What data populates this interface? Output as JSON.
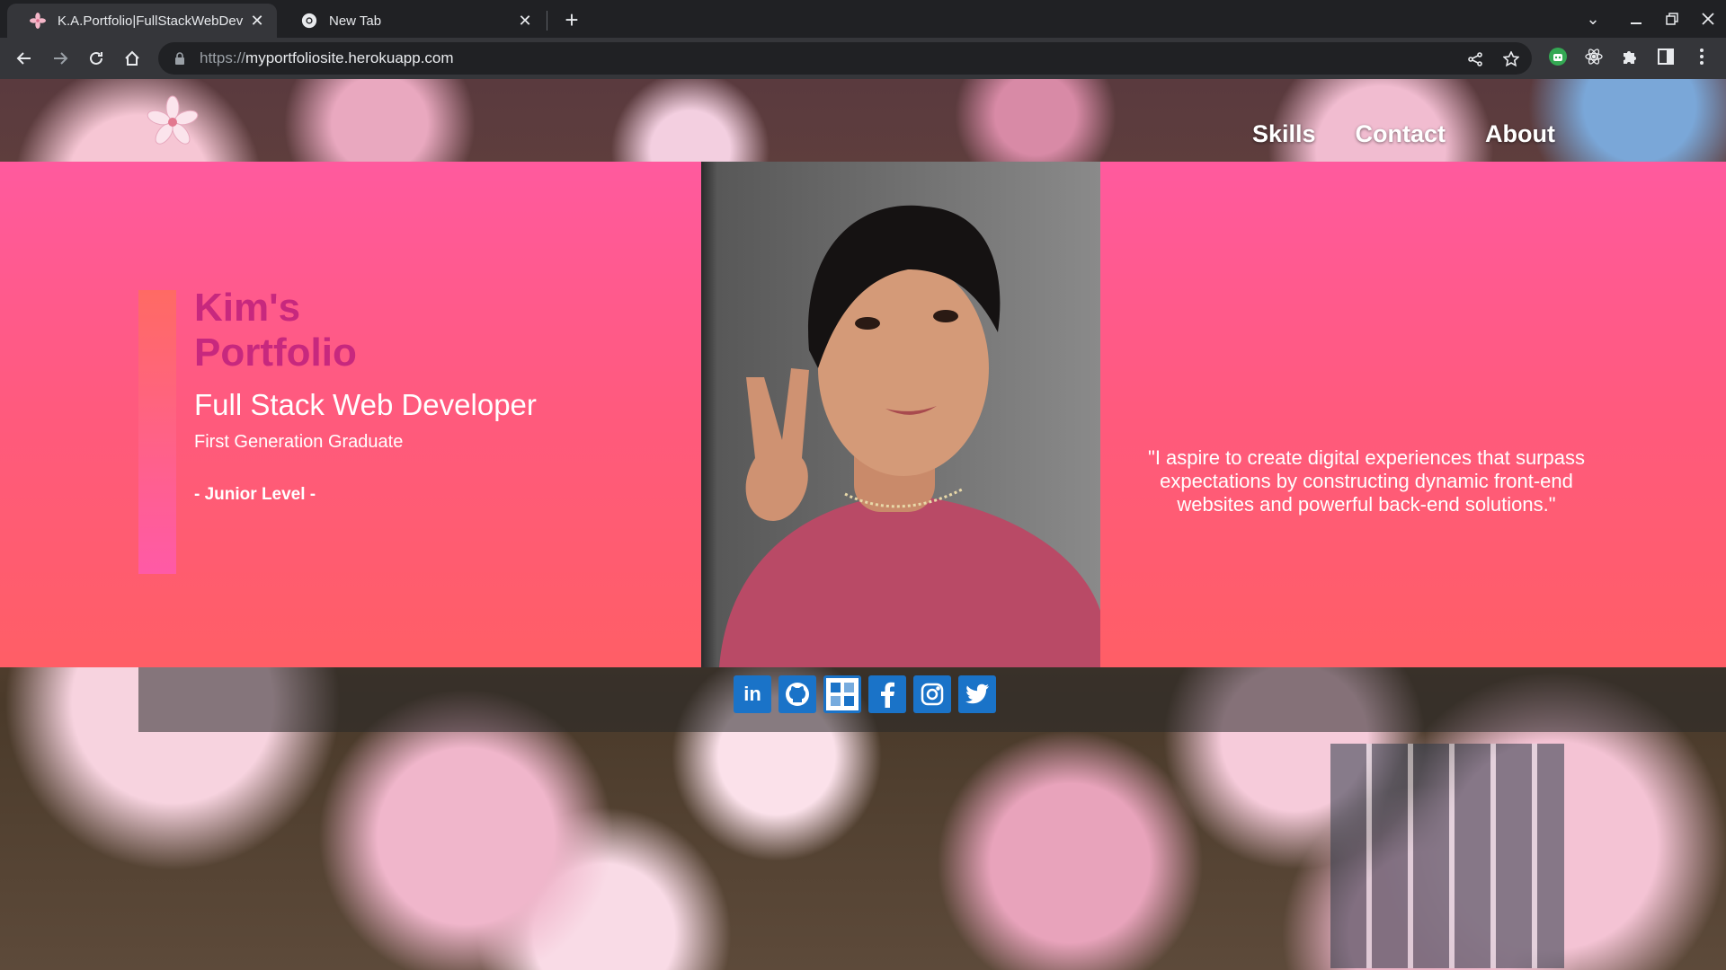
{
  "browser": {
    "tabs": [
      {
        "title": "K.A.Portfolio|FullStackWebDev",
        "active": true
      },
      {
        "title": "New Tab",
        "active": false
      }
    ],
    "url_scheme": "https://",
    "url_host": "myportfoliosite.herokuapp.com"
  },
  "nav": {
    "items": [
      "Skills",
      "Contact",
      "About"
    ]
  },
  "hero": {
    "title": "Kim's Portfolio",
    "subtitle": "Full Stack Web Developer",
    "tagline": "First Generation Graduate",
    "level": "- Junior Level -",
    "quote": "\"I aspire to create digital experiences that surpass expectations by constructing dynamic front-end websites and powerful back-end solutions.\""
  },
  "social": [
    "linkedin-icon",
    "github-icon",
    "codepen-icon",
    "facebook-icon",
    "instagram-icon",
    "twitter-icon"
  ],
  "colors": {
    "hero_pink": "#ff5a9e",
    "title_magenta": "#c7287e",
    "social_blue": "#1a73c8"
  }
}
